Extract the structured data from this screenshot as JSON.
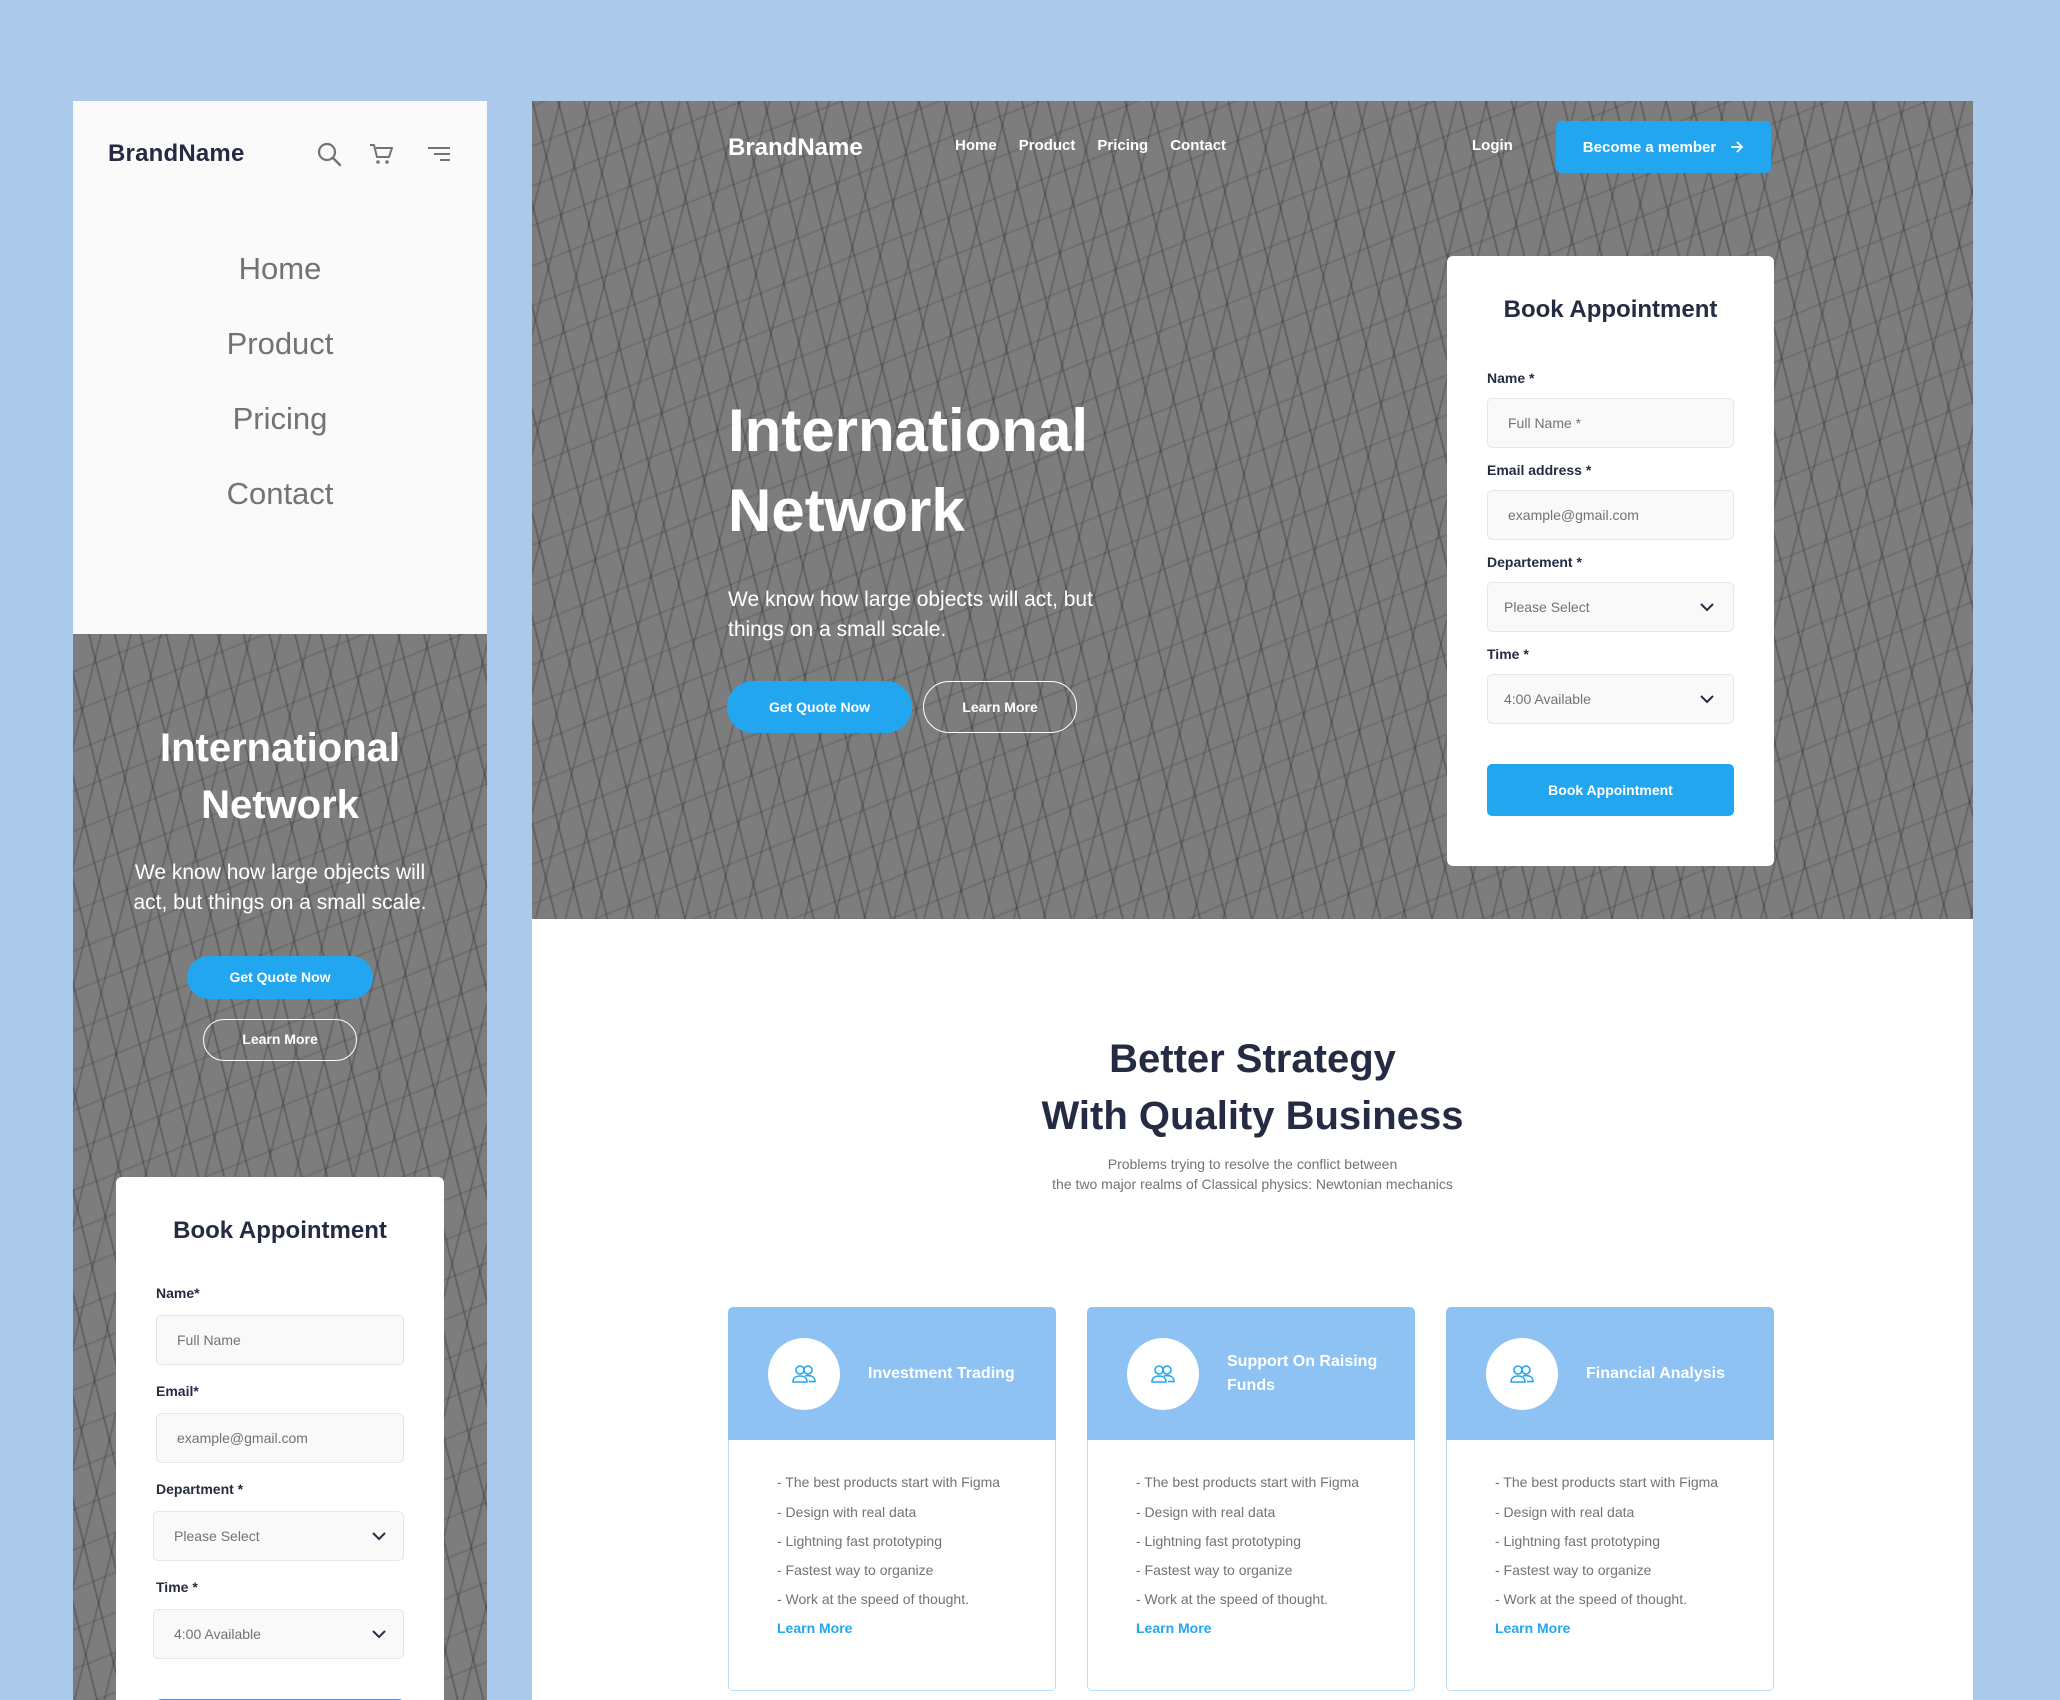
{
  "brand": "BrandName",
  "colors": {
    "background": "#abc9ea",
    "primary": "#23a6f0",
    "heading": "#252b42",
    "muted": "#737373",
    "service_header": "#8ec2f2"
  },
  "mobile": {
    "brand": "BrandName",
    "icons": [
      "search-icon",
      "cart-icon",
      "menu-icon"
    ],
    "nav": [
      "Home",
      "Product",
      "Pricing",
      "Contact"
    ],
    "hero": {
      "title": "International Network",
      "text": "We know how large objects will act, but things on a small scale.",
      "primary_button": "Get Quote Now",
      "secondary_button": "Learn More"
    },
    "form": {
      "title": "Book Appointment",
      "name_label": "Name*",
      "name_placeholder": "Full Name",
      "email_label": "Email*",
      "email_placeholder": "example@gmail.com",
      "department_label": "Department *",
      "department_value": "Please Select",
      "time_label": "Time *",
      "time_value": "4:00 Available"
    }
  },
  "desktop": {
    "brand": "BrandName",
    "nav": [
      "Home",
      "Product",
      "Pricing",
      "Contact"
    ],
    "login": "Login",
    "member_button": "Become a member",
    "hero": {
      "title": "International Network",
      "text": "We know how large objects will act, but things on a small scale.",
      "primary_button": "Get Quote Now",
      "secondary_button": "Learn More"
    },
    "form": {
      "title": "Book Appointment",
      "name_label": "Name *",
      "name_placeholder": "Full Name *",
      "email_label": "Email address *",
      "email_placeholder": "example@gmail.com",
      "department_label": "Departement *",
      "department_value": "Please Select",
      "time_label": "Time *",
      "time_value": "4:00 Available",
      "submit": "Book Appointment"
    },
    "section": {
      "title_line1": "Better Strategy",
      "title_line2": "With Quality Business",
      "text_line1": "Problems trying to resolve the conflict between",
      "text_line2": "the two major realms of Classical physics: Newtonian mechanics"
    },
    "services": [
      {
        "title": "Investment Trading",
        "items": [
          "-  The best products start with Figma",
          "- Design with real data",
          "- Lightning fast prototyping",
          "- Fastest way to organize",
          "- Work at the speed of thought."
        ],
        "link": "Learn More"
      },
      {
        "title": "Support On Raising Funds",
        "items": [
          "-  The best products start with Figma",
          "- Design with real data",
          "- Lightning fast prototyping",
          "- Fastest way to organize",
          "- Work at the speed of thought."
        ],
        "link": "Learn More"
      },
      {
        "title": "Financial Analysis",
        "items": [
          "-  The best products start with Figma",
          "- Design with real data",
          "- Lightning fast prototyping",
          "- Fastest way to organize",
          "- Work at the speed of thought."
        ],
        "link": "Learn More"
      }
    ]
  }
}
